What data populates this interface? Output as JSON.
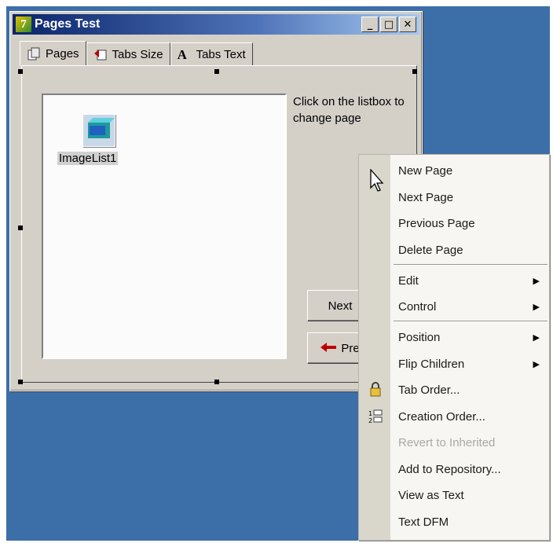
{
  "window": {
    "title": "Pages Test",
    "app_icon_glyph": "7",
    "controls": {
      "minimize": "_",
      "maximize": "□",
      "close": "✕"
    }
  },
  "tabs": [
    {
      "label": "Pages",
      "icon": "pages-icon"
    },
    {
      "label": "Tabs Size",
      "icon": "tabs-size-icon"
    },
    {
      "label": "Tabs Text",
      "icon": "font-a-icon",
      "icon_glyph": "A"
    }
  ],
  "listbox": {
    "item_label": "ImageList1",
    "item_icon": "imagelist-icon"
  },
  "hint": "Click on the listbox to change page",
  "buttons": {
    "next": "Next",
    "previous": "Pre"
  },
  "context_menu": {
    "items": [
      {
        "label": "New Page"
      },
      {
        "label": "Next Page"
      },
      {
        "label": "Previous Page"
      },
      {
        "label": "Delete Page"
      },
      {
        "label": "Edit",
        "submenu": true
      },
      {
        "label": "Control",
        "submenu": true
      },
      {
        "label": "Position",
        "submenu": true
      },
      {
        "label": "Flip Children",
        "submenu": true
      },
      {
        "label": "Tab Order...",
        "icon": "tab-order-icon"
      },
      {
        "label": "Creation Order...",
        "icon": "creation-order-icon"
      },
      {
        "label": "Revert to Inherited",
        "disabled": true
      },
      {
        "label": "Add to Repository..."
      },
      {
        "label": "View as Text"
      },
      {
        "label": "Text DFM"
      }
    ]
  },
  "colors": {
    "desktop": "#3c6ea8",
    "titlebar": "#0a246a",
    "face": "#d4d0c8",
    "disabled_text": "#a8a8a8"
  }
}
